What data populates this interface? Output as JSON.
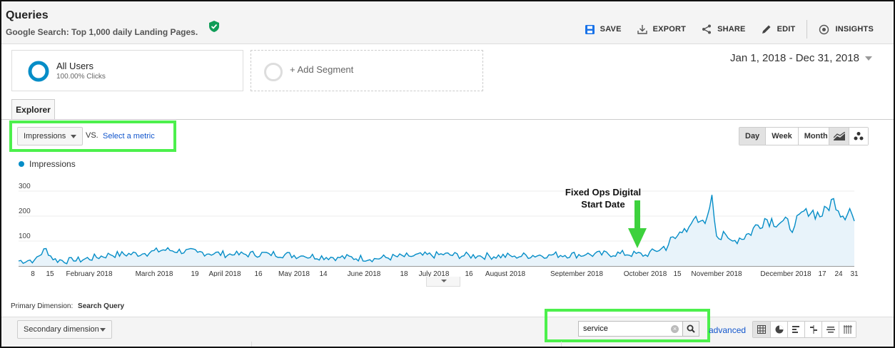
{
  "header": {
    "title": "Queries",
    "subtitle": "Google Search: Top 1,000 daily Landing Pages.",
    "toolbar": {
      "save": "SAVE",
      "export": "EXPORT",
      "share": "SHARE",
      "edit": "EDIT",
      "insights": "INSIGHTS"
    }
  },
  "segments": {
    "active": {
      "name": "All Users",
      "sub": "100.00% Clicks"
    },
    "add_label": "+ Add Segment"
  },
  "date_range": "Jan 1, 2018 - Dec 31, 2018",
  "tabs": {
    "explorer": "Explorer"
  },
  "metric": {
    "primary": "Impressions",
    "vs": "VS.",
    "select": "Select a metric"
  },
  "granularity": {
    "day": "Day",
    "week": "Week",
    "month": "Month",
    "selected": "Day"
  },
  "chart_data": {
    "type": "area",
    "legend": [
      "Impressions"
    ],
    "series_color": "#058dc7",
    "y_ticks": [
      100,
      200,
      300
    ],
    "ylim": [
      0,
      310
    ],
    "x_tick_labels": [
      "8",
      "15",
      "February 2018",
      "March 2018",
      "19",
      "April 2018",
      "16",
      "May 2018",
      "14",
      "June 2018",
      "18",
      "July 2018",
      "16",
      "August 2018",
      "September 2018",
      "October 2018",
      "15",
      "November 2018",
      "December 2018",
      "17",
      "24",
      "31"
    ],
    "annotation": {
      "line1": "Fixed Ops Digital",
      "line2": "Start Date"
    },
    "monthly_values": {
      "Jan 2018": [
        20,
        30
      ],
      "Feb 2018": [
        30,
        50
      ],
      "Mar 2018": [
        40,
        60
      ],
      "Apr 2018": [
        30,
        50
      ],
      "May 2018": [
        30,
        45
      ],
      "Jun 2018": [
        20,
        40
      ],
      "Jul 2018": [
        30,
        50
      ],
      "Aug 2018": [
        30,
        50
      ],
      "Sep 2018": [
        30,
        55
      ],
      "Oct 2018": [
        60,
        280
      ],
      "Nov 2018": [
        150,
        210
      ],
      "Dec 2018": [
        200,
        270
      ]
    },
    "anchors": [
      [
        "2018-01-01",
        20
      ],
      [
        "2018-01-08",
        25
      ],
      [
        "2018-01-13",
        70
      ],
      [
        "2018-01-16",
        25
      ],
      [
        "2018-01-25",
        20
      ],
      [
        "2018-02-10",
        45
      ],
      [
        "2018-02-25",
        50
      ],
      [
        "2018-03-05",
        65
      ],
      [
        "2018-03-20",
        55
      ],
      [
        "2018-04-05",
        45
      ],
      [
        "2018-04-20",
        50
      ],
      [
        "2018-05-05",
        40
      ],
      [
        "2018-05-20",
        35
      ],
      [
        "2018-06-05",
        30
      ],
      [
        "2018-06-20",
        40
      ],
      [
        "2018-07-05",
        45
      ],
      [
        "2018-07-20",
        40
      ],
      [
        "2018-08-05",
        40
      ],
      [
        "2018-08-20",
        45
      ],
      [
        "2018-09-05",
        45
      ],
      [
        "2018-09-20",
        50
      ],
      [
        "2018-10-01",
        45
      ],
      [
        "2018-10-08",
        70
      ],
      [
        "2018-10-14",
        110
      ],
      [
        "2018-10-18",
        150
      ],
      [
        "2018-10-21",
        170
      ],
      [
        "2018-10-25",
        180
      ],
      [
        "2018-10-28",
        200
      ],
      [
        "2018-10-30",
        285
      ],
      [
        "2018-11-01",
        120
      ],
      [
        "2018-11-08",
        100
      ],
      [
        "2018-11-15",
        130
      ],
      [
        "2018-11-22",
        190
      ],
      [
        "2018-11-29",
        175
      ],
      [
        "2018-12-05",
        160
      ],
      [
        "2018-12-10",
        230
      ],
      [
        "2018-12-17",
        200
      ],
      [
        "2018-12-22",
        270
      ],
      [
        "2018-12-26",
        200
      ],
      [
        "2018-12-29",
        230
      ],
      [
        "2018-12-31",
        180
      ]
    ]
  },
  "primary_dimension": {
    "label": "Primary Dimension:",
    "value": "Search Query"
  },
  "secondary_dimension": "Secondary dimension",
  "search": {
    "value": "service"
  },
  "advanced": "advanced"
}
